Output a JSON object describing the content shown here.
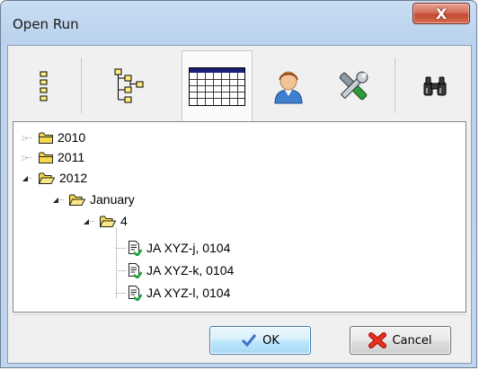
{
  "window": {
    "title": "Open Run",
    "close_glyph": "X"
  },
  "toolbar": {
    "buttons": [
      {
        "name": "list-view",
        "icon": "flat-list-icon",
        "selected": false
      },
      {
        "name": "tree-view",
        "icon": "hierarchy-tree-icon",
        "selected": false
      },
      {
        "name": "calendar-view",
        "icon": "calendar-grid-icon",
        "selected": true
      },
      {
        "name": "user-view",
        "icon": "user-icon",
        "selected": false
      },
      {
        "name": "tools-view",
        "icon": "tools-icon",
        "selected": false
      },
      {
        "name": "find",
        "icon": "binoculars-icon",
        "selected": false
      }
    ]
  },
  "tree": {
    "nodes": [
      {
        "label": "2010",
        "level": 0,
        "expanded": false,
        "type": "folder"
      },
      {
        "label": "2011",
        "level": 0,
        "expanded": false,
        "type": "folder"
      },
      {
        "label": "2012",
        "level": 0,
        "expanded": true,
        "type": "folder"
      },
      {
        "label": "January",
        "level": 1,
        "expanded": true,
        "type": "folder"
      },
      {
        "label": "4",
        "level": 2,
        "expanded": true,
        "type": "folder"
      },
      {
        "label": "JA XYZ-j, 0104",
        "level": 3,
        "type": "run"
      },
      {
        "label": "JA XYZ-k, 0104",
        "level": 3,
        "type": "run"
      },
      {
        "label": "JA XYZ-l, 0104",
        "level": 3,
        "type": "run"
      }
    ]
  },
  "buttons": {
    "ok_label": "OK",
    "cancel_label": "Cancel"
  },
  "colors": {
    "title_bg": "#bcd3ee",
    "close_red": "#c34a31",
    "folder_yellow": "#f6d94b",
    "ok_blue": "#bee6fd"
  }
}
